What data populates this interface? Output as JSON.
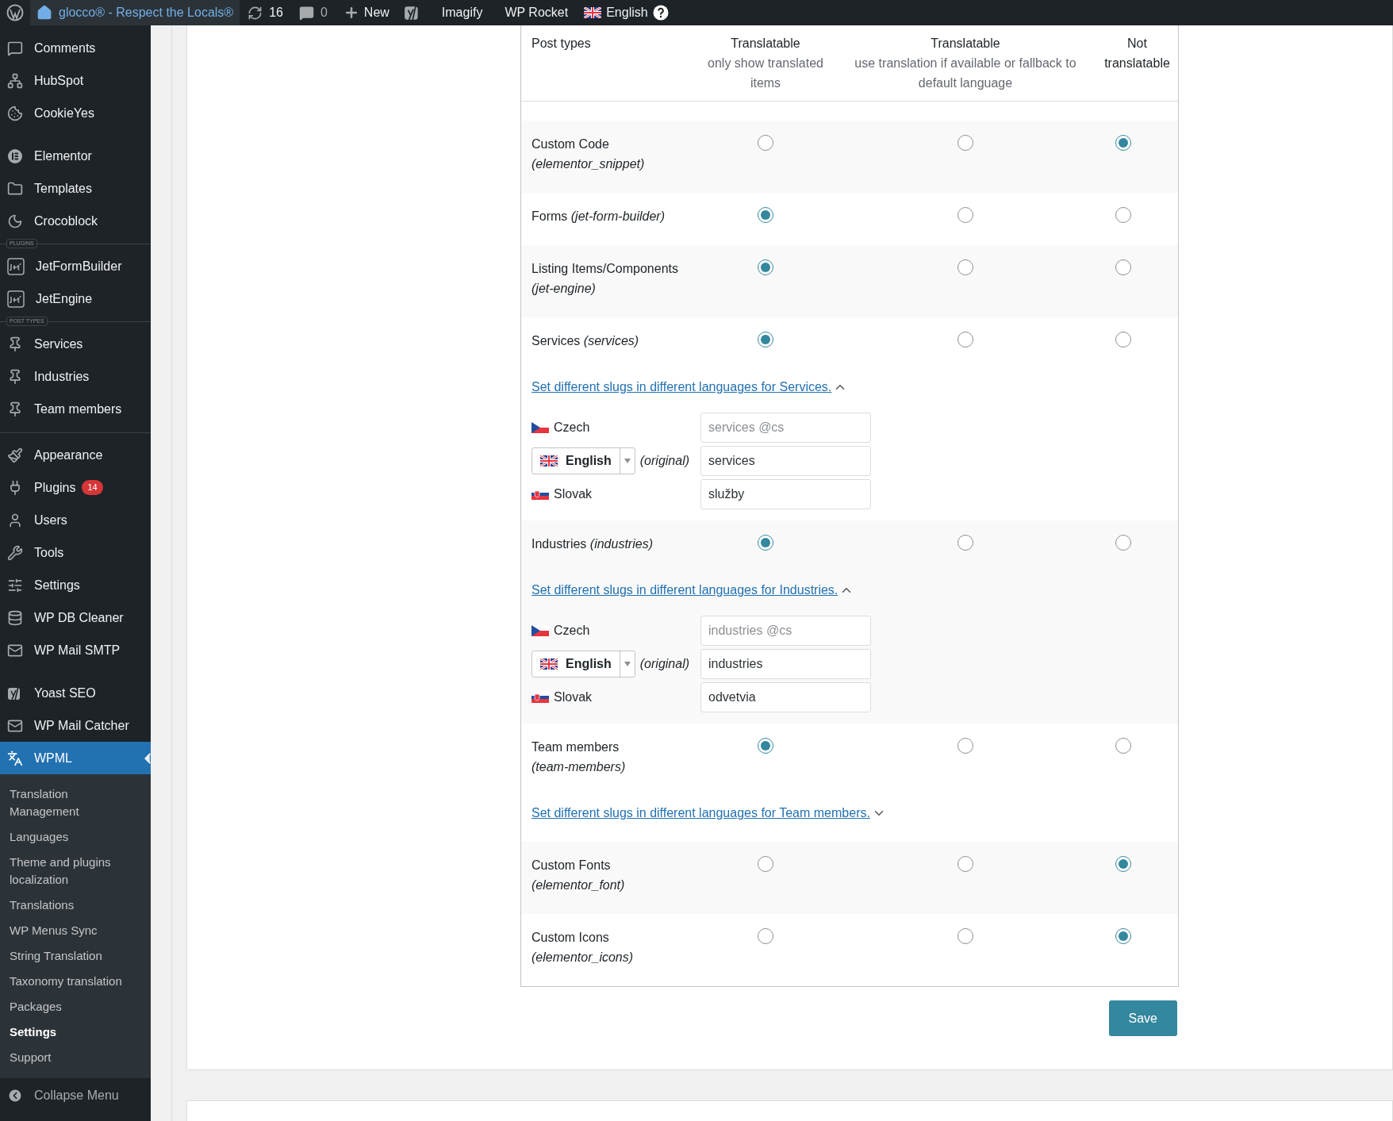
{
  "top_bar": {
    "site_name": "glocco® - Respect the Locals®",
    "updates": "16",
    "comments": "0",
    "new_label": "New",
    "links": [
      "Imagify",
      "WP Rocket"
    ],
    "language": "English"
  },
  "sidebar": {
    "groups": [
      {
        "kind": "none",
        "items": [
          {
            "label": "Comments"
          },
          {
            "label": "HubSpot"
          },
          {
            "label": "CookieYes"
          }
        ]
      },
      {
        "kind": "space",
        "items": [
          {
            "label": "Elementor"
          },
          {
            "label": "Templates"
          },
          {
            "label": "Crocoblock"
          }
        ]
      },
      {
        "kind": "labeled",
        "label": "PLUGINS",
        "items": [
          {
            "label": "JetFormBuilder"
          },
          {
            "label": "JetEngine"
          }
        ]
      },
      {
        "kind": "labeled",
        "label": "POST TYPES",
        "items": [
          {
            "label": "Services"
          },
          {
            "label": "Industries"
          },
          {
            "label": "Team members"
          }
        ]
      },
      {
        "kind": "line",
        "items": [
          {
            "label": "Appearance"
          },
          {
            "label": "Plugins",
            "badge": "14"
          },
          {
            "label": "Users"
          },
          {
            "label": "Tools"
          },
          {
            "label": "Settings"
          },
          {
            "label": "WP DB Cleaner"
          },
          {
            "label": "WP Mail SMTP"
          }
        ]
      },
      {
        "kind": "space",
        "items": [
          {
            "label": "Yoast SEO"
          },
          {
            "label": "WP Mail Catcher"
          }
        ]
      },
      {
        "kind": "none",
        "items": [
          {
            "label": "WPML",
            "selected": true,
            "submenu": [
              {
                "label": "Translation Management",
                "selected": false
              },
              {
                "label": "Languages",
                "selected": false
              },
              {
                "label": "Theme and plugins localization",
                "selected": false
              },
              {
                "label": "Translations",
                "selected": false
              },
              {
                "label": "WP Menus Sync",
                "selected": false
              },
              {
                "label": "String Translation",
                "selected": false
              },
              {
                "label": "Taxonomy translation",
                "selected": false
              },
              {
                "label": "Packages",
                "selected": false
              },
              {
                "label": "Settings",
                "selected": true
              },
              {
                "label": "Support",
                "selected": false
              }
            ]
          }
        ]
      }
    ],
    "collapse": "Collapse Menu"
  },
  "table": {
    "columns": [
      {
        "title": "Post types"
      },
      {
        "title": "Translatable",
        "subtitle": "only show translated items"
      },
      {
        "title": "Translatable",
        "subtitle": "use translation if available or fallback to default language"
      },
      {
        "title": "Not translatable"
      }
    ],
    "rows": [
      {
        "name": "Custom Code",
        "slug": "(elementor_snippet)",
        "options": [
          {
            "selected": false
          },
          {
            "selected": false
          },
          {
            "selected": true
          }
        ]
      },
      {
        "name": "Forms",
        "slug": "(jet-form-builder)",
        "options": [
          {
            "selected": true
          },
          {
            "selected": false
          },
          {
            "selected": false
          }
        ]
      },
      {
        "name": "Listing Items/Components",
        "slug": "(jet-engine)",
        "options": [
          {
            "selected": true
          },
          {
            "selected": false
          },
          {
            "selected": false
          }
        ]
      },
      {
        "name": "Services",
        "slug": "(services)",
        "options": [
          {
            "selected": true
          },
          {
            "selected": false
          },
          {
            "selected": false
          }
        ],
        "slugs": {
          "link": "Set different slugs in different languages for Services.",
          "expanded": true,
          "languages": [
            {
              "kind": "plain",
              "name": "Czech",
              "placeholder": "services @cs"
            },
            {
              "kind": "original",
              "name": "English",
              "note": "(original)",
              "value": "services"
            },
            {
              "kind": "plain",
              "name": "Slovak",
              "value": "služby"
            }
          ]
        }
      },
      {
        "name": "Industries",
        "slug": "(industries)",
        "options": [
          {
            "selected": true
          },
          {
            "selected": false
          },
          {
            "selected": false
          }
        ],
        "slugs": {
          "link": "Set different slugs in different languages for Industries.",
          "expanded": true,
          "languages": [
            {
              "kind": "plain",
              "name": "Czech",
              "placeholder": "industries @cs"
            },
            {
              "kind": "original",
              "name": "English",
              "note": "(original)",
              "value": "industries"
            },
            {
              "kind": "plain",
              "name": "Slovak",
              "value": "odvetvia"
            }
          ]
        }
      },
      {
        "name": "Team members",
        "slug": "(team-members)",
        "options": [
          {
            "selected": true
          },
          {
            "selected": false
          },
          {
            "selected": false
          }
        ],
        "slugs": {
          "link": "Set different slugs in different languages for Team members.",
          "expanded": false
        }
      },
      {
        "name": "Custom Fonts",
        "slug": "(elementor_font)",
        "options": [
          {
            "selected": false
          },
          {
            "selected": false
          },
          {
            "selected": true
          }
        ]
      },
      {
        "name": "Custom Icons",
        "slug": "(elementor_icons)",
        "options": [
          {
            "selected": false
          },
          {
            "selected": false
          },
          {
            "selected": true
          }
        ]
      }
    ]
  },
  "save_button": "Save"
}
